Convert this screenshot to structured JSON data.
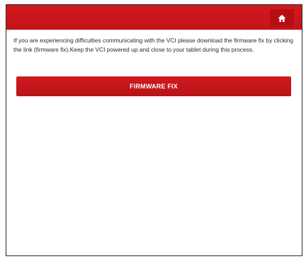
{
  "header": {
    "home_icon": "home-icon",
    "accent_color": "#c8161c"
  },
  "main": {
    "message": "If you are experiencing difficulties communicating with the VCI please download the firmware fix by clicking the link (firmware fix).Keep the VCI powered up and close to your tablet during this process.",
    "firmware_fix_label": "FIRMWARE FIX"
  }
}
